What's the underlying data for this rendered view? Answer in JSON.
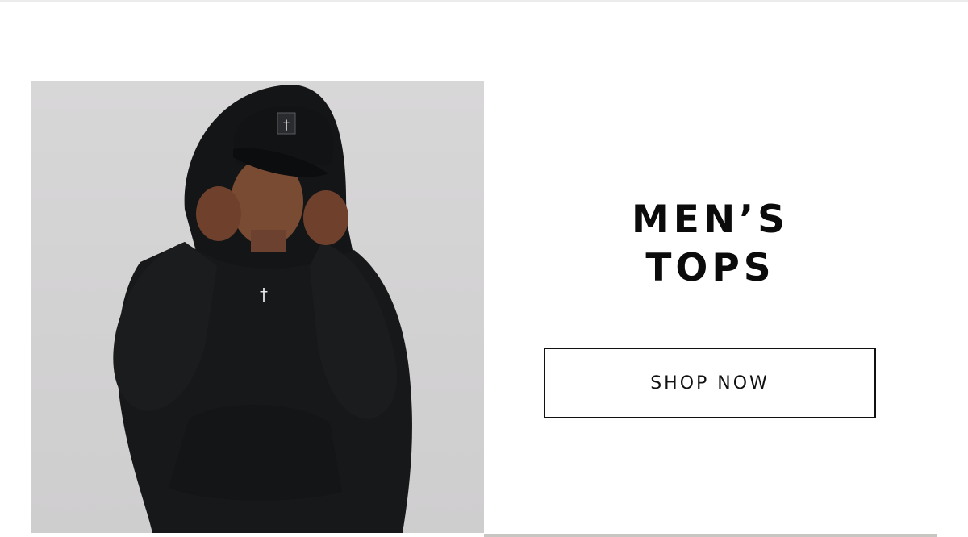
{
  "promo": {
    "image_alt": "Man in black hooded sweatshirt and cap",
    "title_line1": "MEN’S",
    "title_line2": "TOPS",
    "cta_label": "SHOP NOW"
  },
  "colors": {
    "background": "#ffffff",
    "text": "#0b0b0b",
    "image_backdrop": "#d4d3d4",
    "garment": "#17181a"
  }
}
